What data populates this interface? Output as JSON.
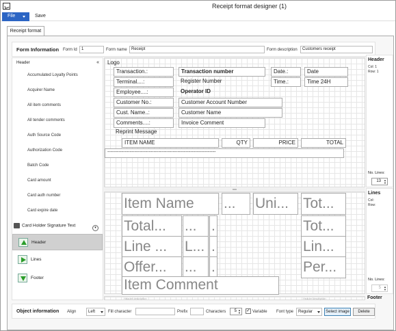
{
  "window": {
    "title": "Receipt format designer (1)"
  },
  "menu": {
    "file": "File",
    "save": "Save"
  },
  "tab": {
    "label": "Receipt format"
  },
  "form_info": {
    "title": "Form Information",
    "form_id_label": "Form Id",
    "form_id_value": "1",
    "form_name_label": "Form name",
    "form_name_value": "Receipt",
    "form_desc_label": "Form description",
    "form_desc_value": "Customers receipt"
  },
  "left_pane": {
    "header_label": "Header",
    "collapse_glyph": "«",
    "items": [
      "Accumulated Loyalty Points",
      "Acquirer Name",
      "All item comments",
      "All tender comments",
      "Auth Source Code",
      "Authorization Code",
      "Batch Code",
      "Card amount",
      "Card auth number",
      "Card expire date"
    ],
    "last_item": "Card Holder Signature Text",
    "nav": [
      "Header",
      "Lines",
      "Footer"
    ]
  },
  "header_fields": {
    "logo": "Logo",
    "transaction_lbl": "Transaction.:",
    "transaction_num": "Transaction number",
    "date_lbl": "Date.:",
    "date_val": "Date",
    "terminal_lbl": "Terminal....:",
    "register_num": "Register Number",
    "time_lbl": "Time.:",
    "time_val": "Time 24H",
    "employee_lbl": "Employee....:",
    "operator_id": "Operator ID",
    "custno_lbl": "Customer No.:",
    "cust_acct": "Customer Account Number",
    "custname_lbl": "Cust. Name..:",
    "cust_name": "Customer Name",
    "comments_lbl": "Comments....:",
    "invoice_comment": "Invoice Comment",
    "reprint": "Reprint Message",
    "item_name": "ITEM NAME",
    "qty": "QTY",
    "price": "PRICE",
    "total": "TOTAL",
    "dashes": "--------------------------------------------------------------------"
  },
  "lines_fields": {
    "r1": [
      "Item Name",
      "...",
      "Uni...",
      "Tot..."
    ],
    "r2": [
      "Total...",
      "...",
      ".",
      "Tot..."
    ],
    "r3": [
      "Line ...",
      "L...",
      ".",
      "Lin..."
    ],
    "r4": [
      "Offer...",
      "...",
      ".",
      "Per..."
    ],
    "r5": "Item Comment"
  },
  "right_header": {
    "title": "Header",
    "col": "Col: 1",
    "row": "Row: 1",
    "nolines_label": "No. Lines:",
    "nolines": "13"
  },
  "right_lines": {
    "title": "Lines",
    "col": "Col:",
    "row": "Row:",
    "nolines_label": "No. Lines:",
    "nolines": "5"
  },
  "right_footer": {
    "title": "Footer"
  },
  "footer_faint": [
    "Header description",
    "Header description"
  ],
  "object_info": {
    "title": "Object information",
    "align_label": "Align",
    "align_value": "Left",
    "fill_label": "Fill character",
    "prefix_label": "Prefix",
    "chars_label": "Characters",
    "chars_value": "5",
    "variable_label": "Variable",
    "font_label": "Font type",
    "font_value": "Regular",
    "select_image": "Select image",
    "delete": "Delete"
  }
}
